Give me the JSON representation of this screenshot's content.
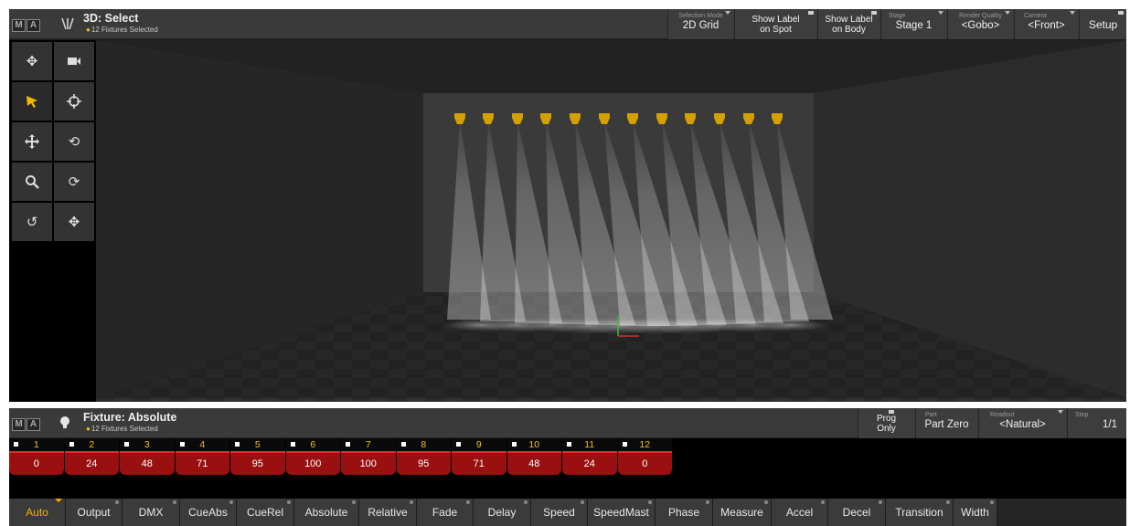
{
  "logo": "MA",
  "win3d": {
    "title": "3D: Select",
    "subtitle": "12 Fixtures Selected",
    "toolbar": {
      "selection_mode_label": "Selection Mode",
      "selection_mode_value": "2D Grid",
      "show_label_spot_line1": "Show Label",
      "show_label_spot_line2": "on Spot",
      "show_label_body_line1": "Show Label",
      "show_label_body_line2": "on Body",
      "stage_label": "Stage",
      "stage_value": "Stage 1",
      "render_quality_label": "Render Quality",
      "render_quality_value": "<Gobo>",
      "camera_label": "Camera",
      "camera_value": "<Front>",
      "setup": "Setup"
    },
    "tools": [
      "move-icon",
      "camera-icon",
      "select-arrow-icon",
      "target-icon",
      "pan-icon",
      "rotate-icon",
      "zoom-icon",
      "rotate-alt-icon",
      "orbit-icon",
      "move-alt-icon"
    ]
  },
  "winfix": {
    "title": "Fixture: Absolute",
    "subtitle": "12 Fixtures Selected",
    "toolbar": {
      "prog_only_line1": "Prog",
      "prog_only_line2": "Only",
      "part_label": "Part",
      "part_value": "Part Zero",
      "readout_label": "Readout",
      "readout_value": "<Natural>",
      "step_label": "Step",
      "step_value": "1/1"
    },
    "fixtures": [
      {
        "num": "1",
        "value": "0"
      },
      {
        "num": "2",
        "value": "24"
      },
      {
        "num": "3",
        "value": "48"
      },
      {
        "num": "4",
        "value": "71"
      },
      {
        "num": "5",
        "value": "95"
      },
      {
        "num": "6",
        "value": "100"
      },
      {
        "num": "7",
        "value": "100"
      },
      {
        "num": "8",
        "value": "95"
      },
      {
        "num": "9",
        "value": "71"
      },
      {
        "num": "10",
        "value": "48"
      },
      {
        "num": "11",
        "value": "24"
      },
      {
        "num": "12",
        "value": "0"
      }
    ],
    "tabs": [
      "Auto",
      "Output",
      "DMX",
      "CueAbs",
      "CueRel",
      "Absolute",
      "Relative",
      "Fade",
      "Delay",
      "Speed",
      "SpeedMast",
      "Phase",
      "Measure",
      "Accel",
      "Decel",
      "Transition",
      "Width"
    ],
    "active_tab": "Auto"
  },
  "colors": {
    "accent": "#f0b000",
    "fixture_value_bg": "#9a1010",
    "fixture_yellow": "#d4a000"
  }
}
